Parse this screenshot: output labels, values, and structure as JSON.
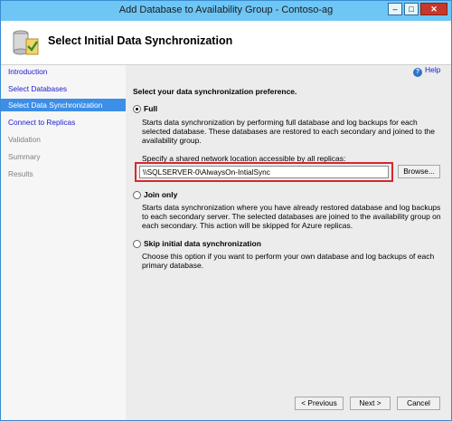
{
  "window": {
    "title": "Add Database to Availability Group - Contoso-ag"
  },
  "header": {
    "title": "Select Initial Data Synchronization"
  },
  "sidebar": {
    "items": [
      {
        "label": "Introduction"
      },
      {
        "label": "Select Databases"
      },
      {
        "label": "Select Data Synchronization"
      },
      {
        "label": "Connect to Replicas"
      },
      {
        "label": "Validation"
      },
      {
        "label": "Summary"
      },
      {
        "label": "Results"
      }
    ]
  },
  "help": {
    "label": "Help"
  },
  "main": {
    "prompt": "Select your data synchronization preference.",
    "options": {
      "full": {
        "label": "Full",
        "description": "Starts data synchronization by performing full database and log backups for each selected database. These databases are restored to each secondary and joined to the availability group.",
        "network_label": "Specify a shared network location accessible by all replicas:",
        "network_value": "\\\\SQLSERVER-0\\AlwaysOn-IntialSync",
        "browse_label": "Browse..."
      },
      "join": {
        "label": "Join only",
        "description": "Starts data synchronization where you have already restored database and log backups to each secondary server. The selected databases are joined to the availability group on each secondary. This action will be skipped for Azure replicas."
      },
      "skip": {
        "label": "Skip initial data synchronization",
        "description": "Choose this option if you want to perform your own database and log backups of each primary database."
      }
    },
    "selected_option": "Full"
  },
  "footer": {
    "previous_label": "< Previous",
    "next_label": "Next >",
    "cancel_label": "Cancel"
  },
  "colors": {
    "titlebar": "#6ec6f5",
    "selected_nav": "#3c8ee6",
    "highlight_border": "#d6282c",
    "link": "#1a1ad0"
  }
}
